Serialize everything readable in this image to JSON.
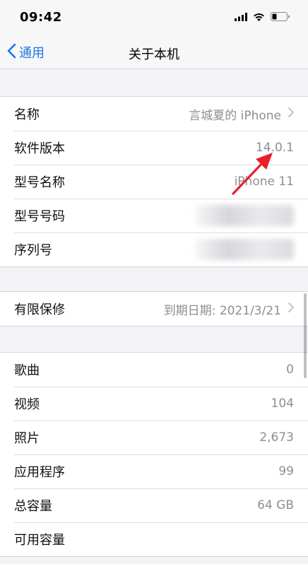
{
  "status_bar": {
    "time": "09:42"
  },
  "nav": {
    "back_label": "通用",
    "title": "关于本机"
  },
  "group1": [
    {
      "label": "名称",
      "value": "言城夏的 iPhone",
      "chevron": true
    },
    {
      "label": "软件版本",
      "value": "14.0.1"
    },
    {
      "label": "型号名称",
      "value": "iPhone 11"
    },
    {
      "label": "型号号码",
      "value": ""
    },
    {
      "label": "序列号",
      "value": ""
    }
  ],
  "group2": [
    {
      "label": "有限保修",
      "value": "到期日期: 2021/3/21",
      "chevron": true
    }
  ],
  "group3": [
    {
      "label": "歌曲",
      "value": "0"
    },
    {
      "label": "视频",
      "value": "104"
    },
    {
      "label": "照片",
      "value": "2,673"
    },
    {
      "label": "应用程序",
      "value": "99"
    },
    {
      "label": "总容量",
      "value": "64 GB"
    },
    {
      "label": "可用容量",
      "value": ""
    }
  ],
  "annotation_color": "#e8202a",
  "accent": "#1f76e8"
}
